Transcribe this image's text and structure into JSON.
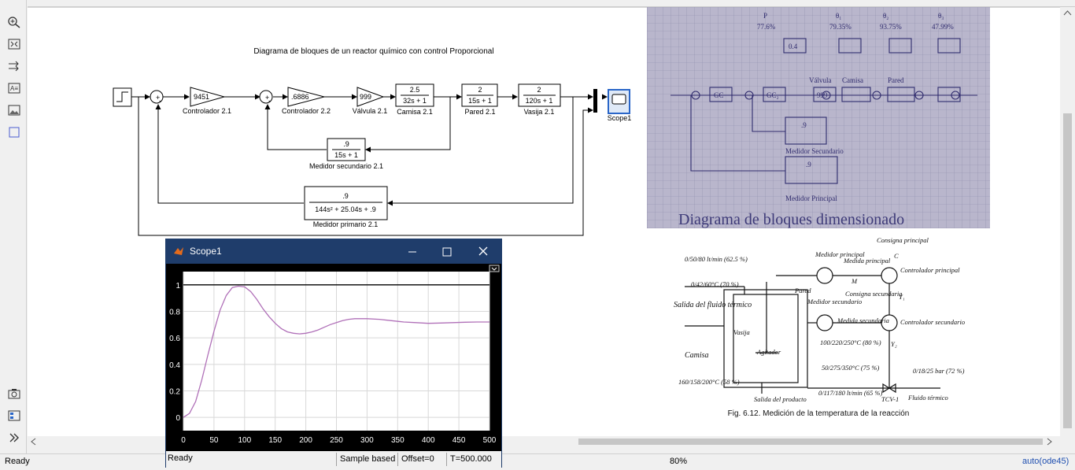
{
  "toolbar": {
    "icons": [
      "zoom-in-icon",
      "fit-view-icon",
      "signal-arrows-icon",
      "annotation-icon",
      "image-icon",
      "area-icon",
      "camera-icon",
      "model-browser-icon",
      "expand-icon"
    ]
  },
  "diagram": {
    "title": "Diagrama de bloques de un reactor químico con control Proporcional",
    "blocks": {
      "c1": {
        "value": "9451",
        "label": "Controlador 2.1"
      },
      "c2": {
        "value": ".6886",
        "label": "Controlador 2.2"
      },
      "valve": {
        "value": "999",
        "label": "Válvula 2.1"
      },
      "camisa": {
        "num": "2.5",
        "den": "32s + 1",
        "label": "Camisa 2.1"
      },
      "pared": {
        "num": "2",
        "den": "15s + 1",
        "label": "Pared 2.1"
      },
      "vasija": {
        "num": "2",
        "den": "120s + 1",
        "label": "Vasija 2.1"
      },
      "ms": {
        "num": ".9",
        "den": "15s + 1",
        "label": "Medidor secundario 2.1"
      },
      "mp": {
        "num": ".9",
        "den": "144s² + 25.04s + .9",
        "label": "Medidor primario 2.1"
      },
      "scope": {
        "label": "Scope1"
      }
    }
  },
  "photo": {
    "caption": "Diagrama de bloques dimensionado",
    "header_values": [
      "P",
      "θ₁",
      "θ₂",
      "θ₃",
      "77.6%",
      "79.35%",
      "93.75%",
      "47.99%"
    ],
    "blocks": [
      "0.4",
      "GC",
      "GC₂",
      "999",
      ".9",
      ".9"
    ],
    "labels": [
      "Válvula",
      "Camisa",
      "Pared",
      "Medidor Secundario",
      "Medidor Principal"
    ]
  },
  "pid": {
    "caption": "Fig. 6.12. Medición de la temperatura de la reacción",
    "texts": {
      "consigna": "Consigna principal",
      "c": "C",
      "medidor_principal": "Medidor principal",
      "medida_principal": "Medida principal",
      "m": "M",
      "controlador_principal": "Controlador principal",
      "qf": "0/50/80 lt/min (62.5 %)",
      "thetaf": "0/42/60°C (70 %)",
      "salida_fluido": "Salida del fluido térmico",
      "pared": "Pared",
      "consigna_sec": "Consigna secundaria",
      "y1": "Y₁",
      "medidor_sec": "Medidor secundario",
      "medida_sec": "Medida secundaria",
      "controlador_sec": "Controlador secundario",
      "vasija": "Vasija",
      "camisa": "Camisa",
      "agitador": "Agitador",
      "theta2": "100/220/250°C (80 %)",
      "y2": "Y₂",
      "theta3": "50/275/350°C (75 %)",
      "theta_temp": "160/158/200°C (58 %)",
      "p": "0/18/25 bar (72 %)",
      "qv": "0/117/180 lt/min (65 %)",
      "salida_producto": "Salida del producto",
      "tcv": "TCV-1",
      "fluido_termico": "Fluido térmico"
    }
  },
  "scope_window": {
    "title": "Scope1",
    "status": {
      "state": "Ready",
      "mode": "Sample based",
      "offset": "Offset=0",
      "time": "T=500.000"
    },
    "chart_data": {
      "type": "line",
      "x": [
        0,
        10,
        20,
        30,
        40,
        50,
        60,
        70,
        80,
        90,
        100,
        110,
        120,
        130,
        140,
        150,
        160,
        170,
        180,
        190,
        200,
        210,
        220,
        230,
        240,
        250,
        260,
        270,
        280,
        290,
        300,
        320,
        340,
        360,
        380,
        400,
        420,
        440,
        460,
        480,
        500
      ],
      "series": [
        {
          "values": [
            0,
            0.03,
            0.12,
            0.28,
            0.47,
            0.65,
            0.81,
            0.92,
            0.98,
            0.99,
            0.985,
            0.95,
            0.89,
            0.82,
            0.76,
            0.71,
            0.67,
            0.645,
            0.635,
            0.63,
            0.635,
            0.645,
            0.66,
            0.68,
            0.7,
            0.715,
            0.73,
            0.74,
            0.745,
            0.745,
            0.745,
            0.74,
            0.73,
            0.72,
            0.715,
            0.71,
            0.712,
            0.715,
            0.718,
            0.72,
            0.72
          ]
        },
        {
          "values": [
            1,
            1,
            1,
            1,
            1,
            1,
            1,
            1,
            1,
            1,
            1,
            1,
            1,
            1,
            1,
            1,
            1,
            1,
            1,
            1,
            1,
            1,
            1,
            1,
            1,
            1,
            1,
            1,
            1,
            1,
            1,
            1,
            1,
            1,
            1,
            1,
            1,
            1,
            1,
            1,
            1
          ]
        }
      ],
      "xlim": [
        0,
        500
      ],
      "ylim": [
        -0.1,
        1.1
      ],
      "xticks": [
        "0",
        "50",
        "100",
        "150",
        "200",
        "250",
        "300",
        "350",
        "400",
        "450",
        "500"
      ],
      "yticks": [
        "0",
        "0.2",
        "0.4",
        "0.6",
        "0.8",
        "1"
      ],
      "grid": true,
      "colors": {
        "response": "#b070b8",
        "setpoint": "#ffffff",
        "background": "#000000"
      }
    }
  },
  "statusbar": {
    "state": "Ready",
    "zoom": "80%",
    "solver": "auto(ode45)"
  }
}
